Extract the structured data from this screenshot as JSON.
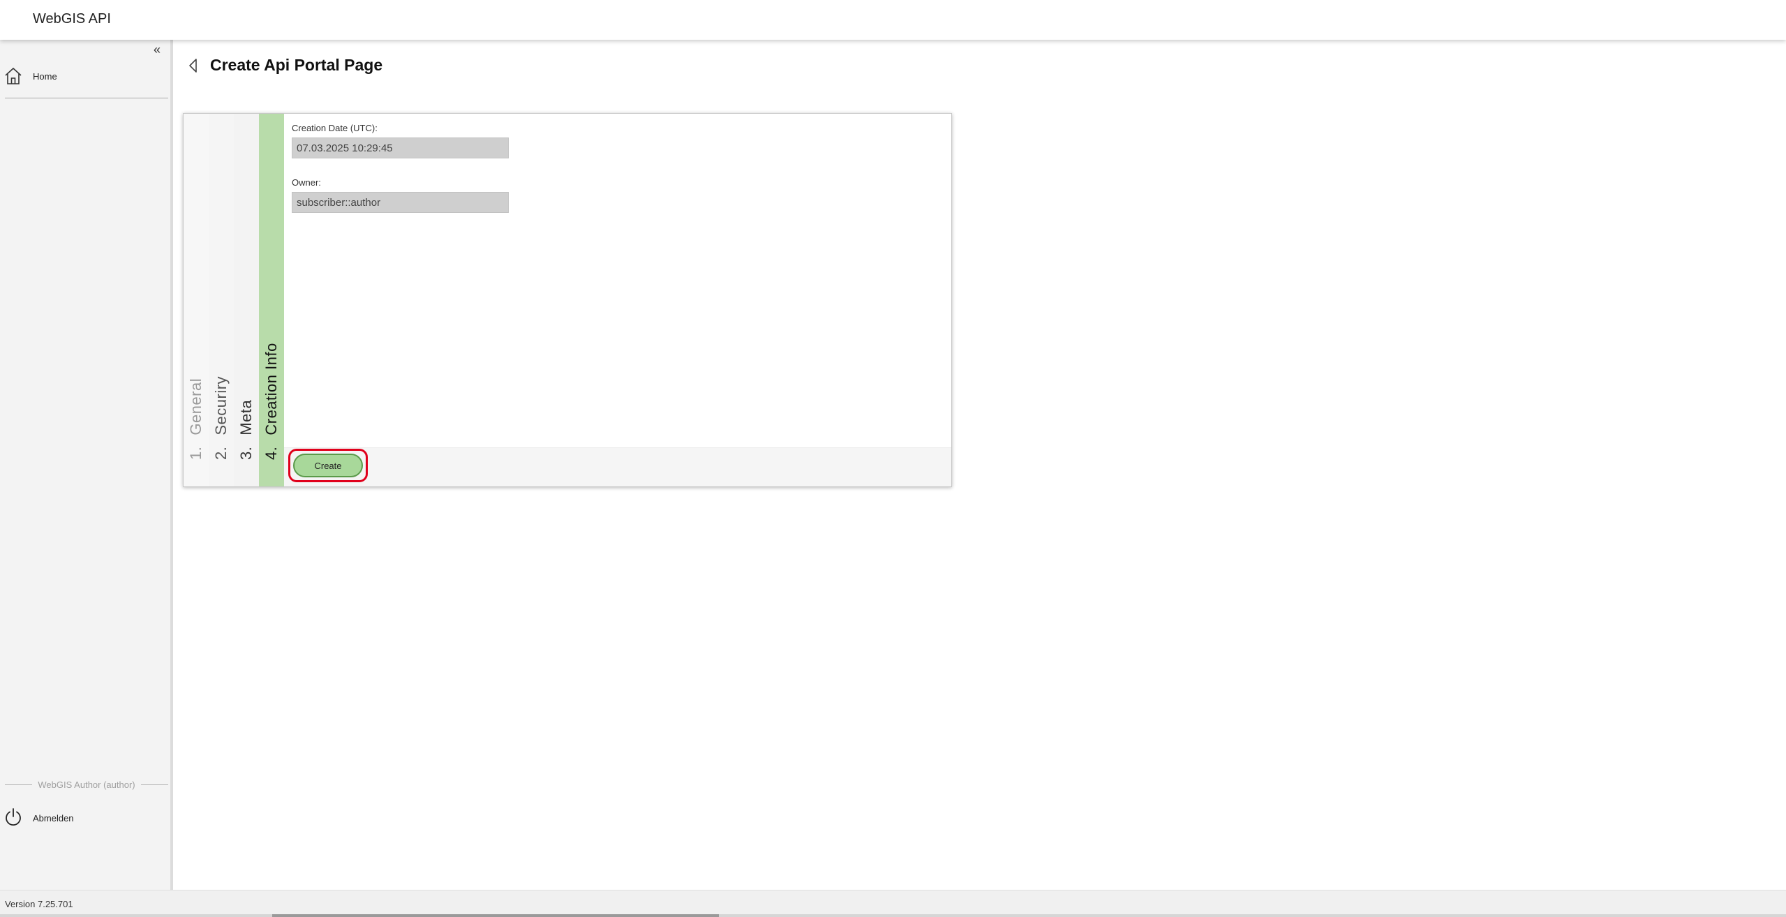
{
  "header": {
    "app_title": "WebGIS API"
  },
  "sidebar": {
    "collapse_glyph": "«",
    "items": [
      {
        "label": "Home",
        "icon": "home-icon"
      }
    ],
    "user_label": "WebGIS Author (author)",
    "logout_label": "Abmelden",
    "logout_icon": "power-icon"
  },
  "page": {
    "title": "Create Api Portal Page",
    "back_icon": "chevron-left-icon"
  },
  "wizard": {
    "steps": [
      {
        "number": "1.",
        "label": "General",
        "active": false
      },
      {
        "number": "2.",
        "label": "Securiry",
        "active": false
      },
      {
        "number": "3.",
        "label": "Meta",
        "active": false
      },
      {
        "number": "4.",
        "label": "Creation Info",
        "active": true
      }
    ],
    "active_color": "#b8dcaa",
    "fields": {
      "creation_date_label": "Creation Date (UTC):",
      "creation_date_value": "07.03.2025 10:29:45",
      "owner_label": "Owner:",
      "owner_value": "subscriber::author"
    },
    "create_label": "Create",
    "create_color": "#a8d89a",
    "highlight_color": "#e0001b"
  },
  "footer": {
    "version": "Version 7.25.701"
  }
}
